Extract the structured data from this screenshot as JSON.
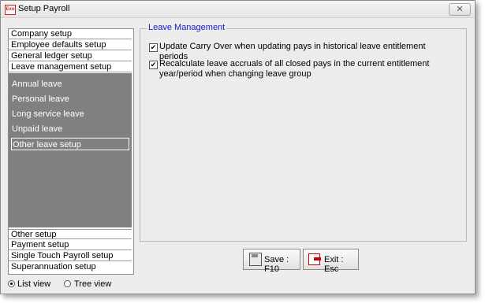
{
  "window": {
    "title": "Setup Payroll",
    "app_icon_text": "Exo",
    "close_symbol": "✕"
  },
  "nav": {
    "top_items": [
      {
        "label": "Company setup"
      },
      {
        "label": "Employee defaults setup"
      },
      {
        "label": "General ledger setup"
      },
      {
        "label": "Leave management setup"
      }
    ],
    "sub_items": [
      {
        "label": "Annual leave"
      },
      {
        "label": "Personal leave"
      },
      {
        "label": "Long service leave"
      },
      {
        "label": "Unpaid leave"
      },
      {
        "label": "Other leave setup",
        "selected": true
      }
    ],
    "bottom_items": [
      {
        "label": "Other setup"
      },
      {
        "label": "Payment setup"
      },
      {
        "label": "Single Touch Payroll setup"
      },
      {
        "label": "Superannuation setup"
      }
    ]
  },
  "content": {
    "group_title": "Leave Management",
    "options": [
      {
        "label": "Update Carry Over when updating pays in historical leave entitlement periods",
        "checked": true
      },
      {
        "label": "Recalculate leave accruals of all closed pays in the current entitlement year/period when changing leave group",
        "checked": true
      }
    ]
  },
  "buttons": {
    "save": "Save : F10",
    "exit": "Exit : Esc"
  },
  "view": {
    "list_label": "List view",
    "tree_label": "Tree view",
    "selected": "list"
  },
  "colors": {
    "group_title": "#1a1acc",
    "subpanel_bg": "#808080",
    "exit_accent": "#cc0000"
  }
}
